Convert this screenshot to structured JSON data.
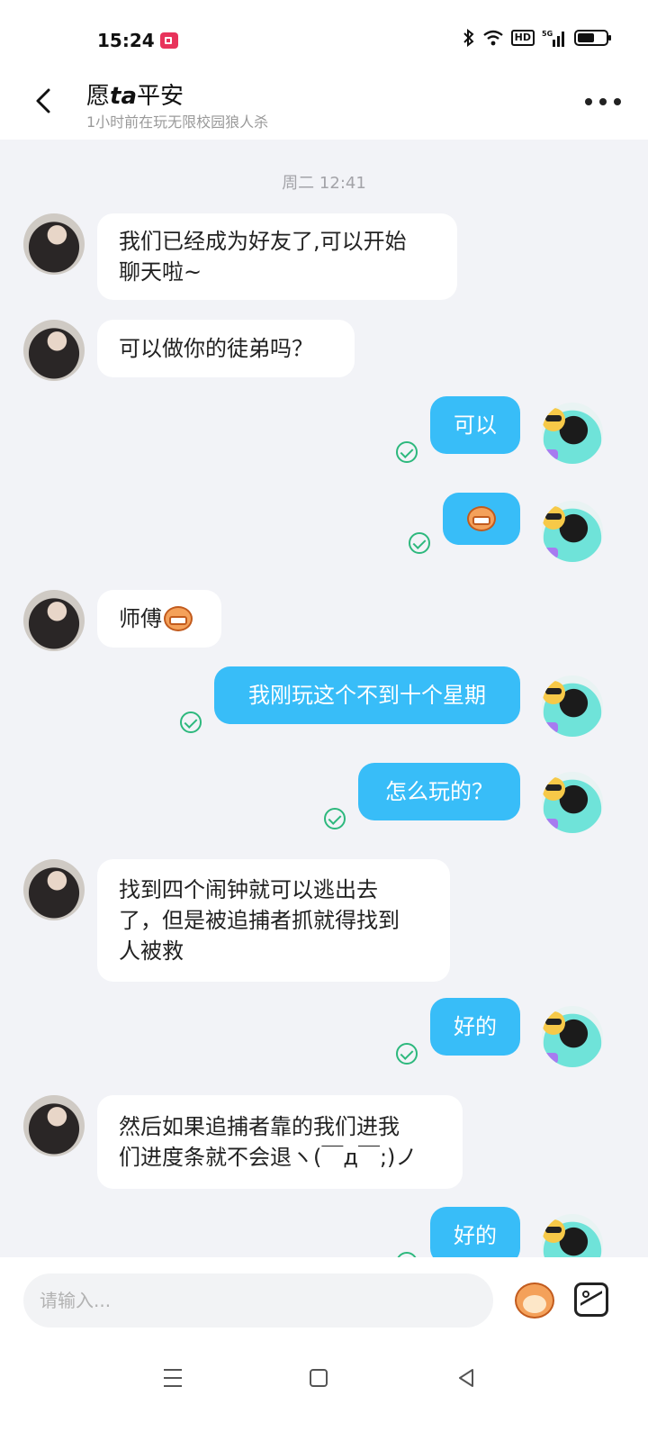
{
  "status_bar": {
    "time": "15:24",
    "network": "5G",
    "hd": "HD",
    "battery_level": 0.6
  },
  "header": {
    "title_prefix": "愿",
    "title_italic": "ta",
    "title_suffix": "平安",
    "subtitle": "1小时前在玩无限校园狼人杀"
  },
  "timestamp": "周二 12:41",
  "messages": [
    {
      "side": "left",
      "text": "我们已经成为好友了,可以开始\n聊天啦~"
    },
    {
      "side": "left",
      "text": "可以做你的徒弟吗？"
    },
    {
      "side": "right",
      "text": "可以"
    },
    {
      "side": "right",
      "text": "",
      "emoji": "laughing-monkey-icon"
    },
    {
      "side": "left",
      "text": "师傅",
      "emoji": "laughing-monkey-icon"
    },
    {
      "side": "right",
      "text": "我刚玩这个不到十个星期"
    },
    {
      "side": "right",
      "text": "怎么玩的？"
    },
    {
      "side": "left",
      "text": "找到四个闹钟就可以逃出去\n了，但是被追捕者抓就得找到\n人被救"
    },
    {
      "side": "right",
      "text": "好的"
    },
    {
      "side": "left",
      "text": "然后如果追捕者靠的我们进我\n们进度条就不会退ヽ(￣д￣;)ノ"
    },
    {
      "side": "right",
      "text": "好的"
    }
  ],
  "input": {
    "placeholder": "请输入..."
  }
}
